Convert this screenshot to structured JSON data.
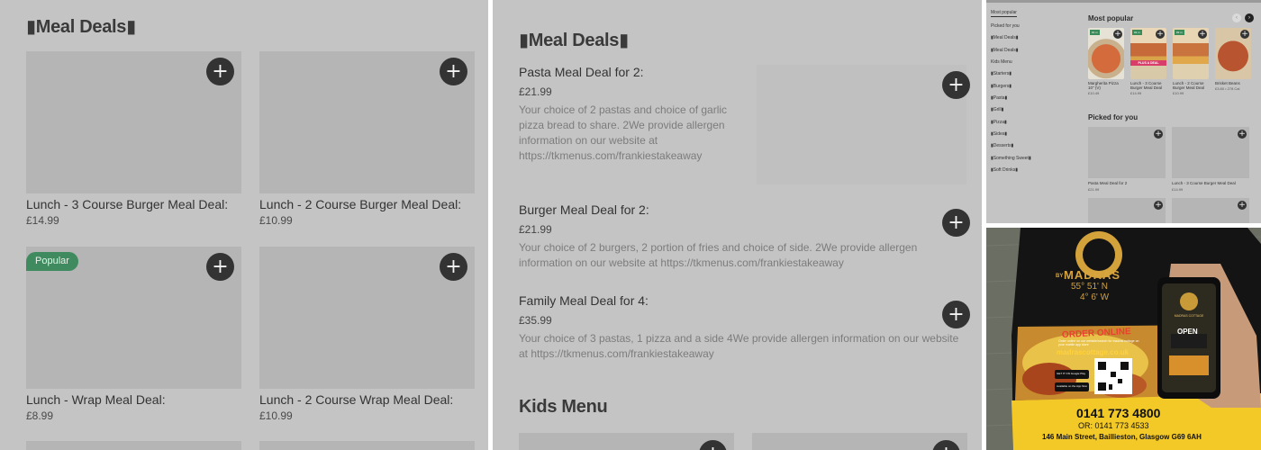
{
  "panel1": {
    "section_title": "▮Meal Deals▮",
    "cards": [
      {
        "name": "Lunch - 3 Course Burger Meal Deal:",
        "price": "£14.99",
        "badge": ""
      },
      {
        "name": "Lunch - 2 Course Burger Meal Deal:",
        "price": "£10.99",
        "badge": ""
      },
      {
        "name": "Lunch - Wrap Meal Deal:",
        "price": "£8.99",
        "badge": "Popular"
      },
      {
        "name": "Lunch - 2 Course Wrap Meal Deal:",
        "price": "£10.99",
        "badge": ""
      }
    ],
    "add_label": "+"
  },
  "panel2": {
    "section_title": "▮Meal Deals▮",
    "deals": [
      {
        "name": "Pasta Meal Deal for 2:",
        "price": "£21.99",
        "description": "Your choice of 2 pastas and choice of garlic pizza bread to share. 2We provide allergen information on our website at https://tkmenus.com/frankiestakeaway"
      },
      {
        "name": "Burger Meal Deal for 2:",
        "price": "£21.99",
        "description": "Your choice of 2 burgers, 2 portion of fries and choice of side. 2We provide allergen information on our website at https://tkmenus.com/frankiestakeaway"
      },
      {
        "name": "Family Meal Deal for 4:",
        "price": "£35.99",
        "description": "Your choice of 3 pastas, 1 pizza and a side 4We provide allergen information on our website at https://tkmenus.com/frankiestakeaway"
      }
    ],
    "kids_title": "Kids Menu"
  },
  "panel3": {
    "sidebar": [
      "Most popular",
      "Picked for you",
      "▮Meal Deals▮",
      "▮Meal Deals▮",
      "Kids Menu",
      "▮Starters▮",
      "▮Burgers▮",
      "▮Pasta▮",
      "▮Grill▮",
      "▮Pizza▮",
      "▮Sides▮",
      "▮Desserts▮",
      "▮Something Sweet▮",
      "▮Soft Drinks▮"
    ],
    "most_popular_title": "Most popular",
    "picked_title": "Picked for you",
    "nav_prev": "‹",
    "nav_next": "›",
    "popular_items": [
      {
        "name": "Margherita Pizza 10\" (V)",
        "price": "£10.49",
        "tag": "#1 m"
      },
      {
        "name": "Lunch - 3 Course Burger Meal Deal",
        "price": "£14.99",
        "tag": "#2 m"
      },
      {
        "name": "Lunch - 2 Course Burger Meal Deal",
        "price": "£10.99",
        "tag": "#3 m"
      },
      {
        "name": "Brisket Beans",
        "price": "£3.80 • 278 Cal",
        "tag": ""
      }
    ],
    "promo_text": "PLUS A DEAL",
    "picked_items": [
      {
        "name": "Pasta Meal Deal for 2",
        "price": "£21.99"
      },
      {
        "name": "Lunch - 3 Course Burger Meal Deal",
        "price": "£14.99"
      }
    ]
  },
  "panel4": {
    "brand_by": "BY",
    "brand_name": "MADRAS",
    "coords_lat": "55° 51' N",
    "coords_lon": "4° 6' W",
    "order_online": "ORDER ONLINE",
    "order_small": "Order online on our website/search for madras cottage on your mobile app store",
    "website": "madrascottage.co.uk",
    "google_play": "GET IT ON Google Play",
    "app_store": "Available on the App Store",
    "phone_main": "0141 773 4800",
    "phone_alt": "OR: 0141 773 4533",
    "address": "146 Main Street, Baillieston, Glasgow G69 6AH",
    "phone_open": "OPEN",
    "phone_header": "MADRAS COTTAGE"
  }
}
